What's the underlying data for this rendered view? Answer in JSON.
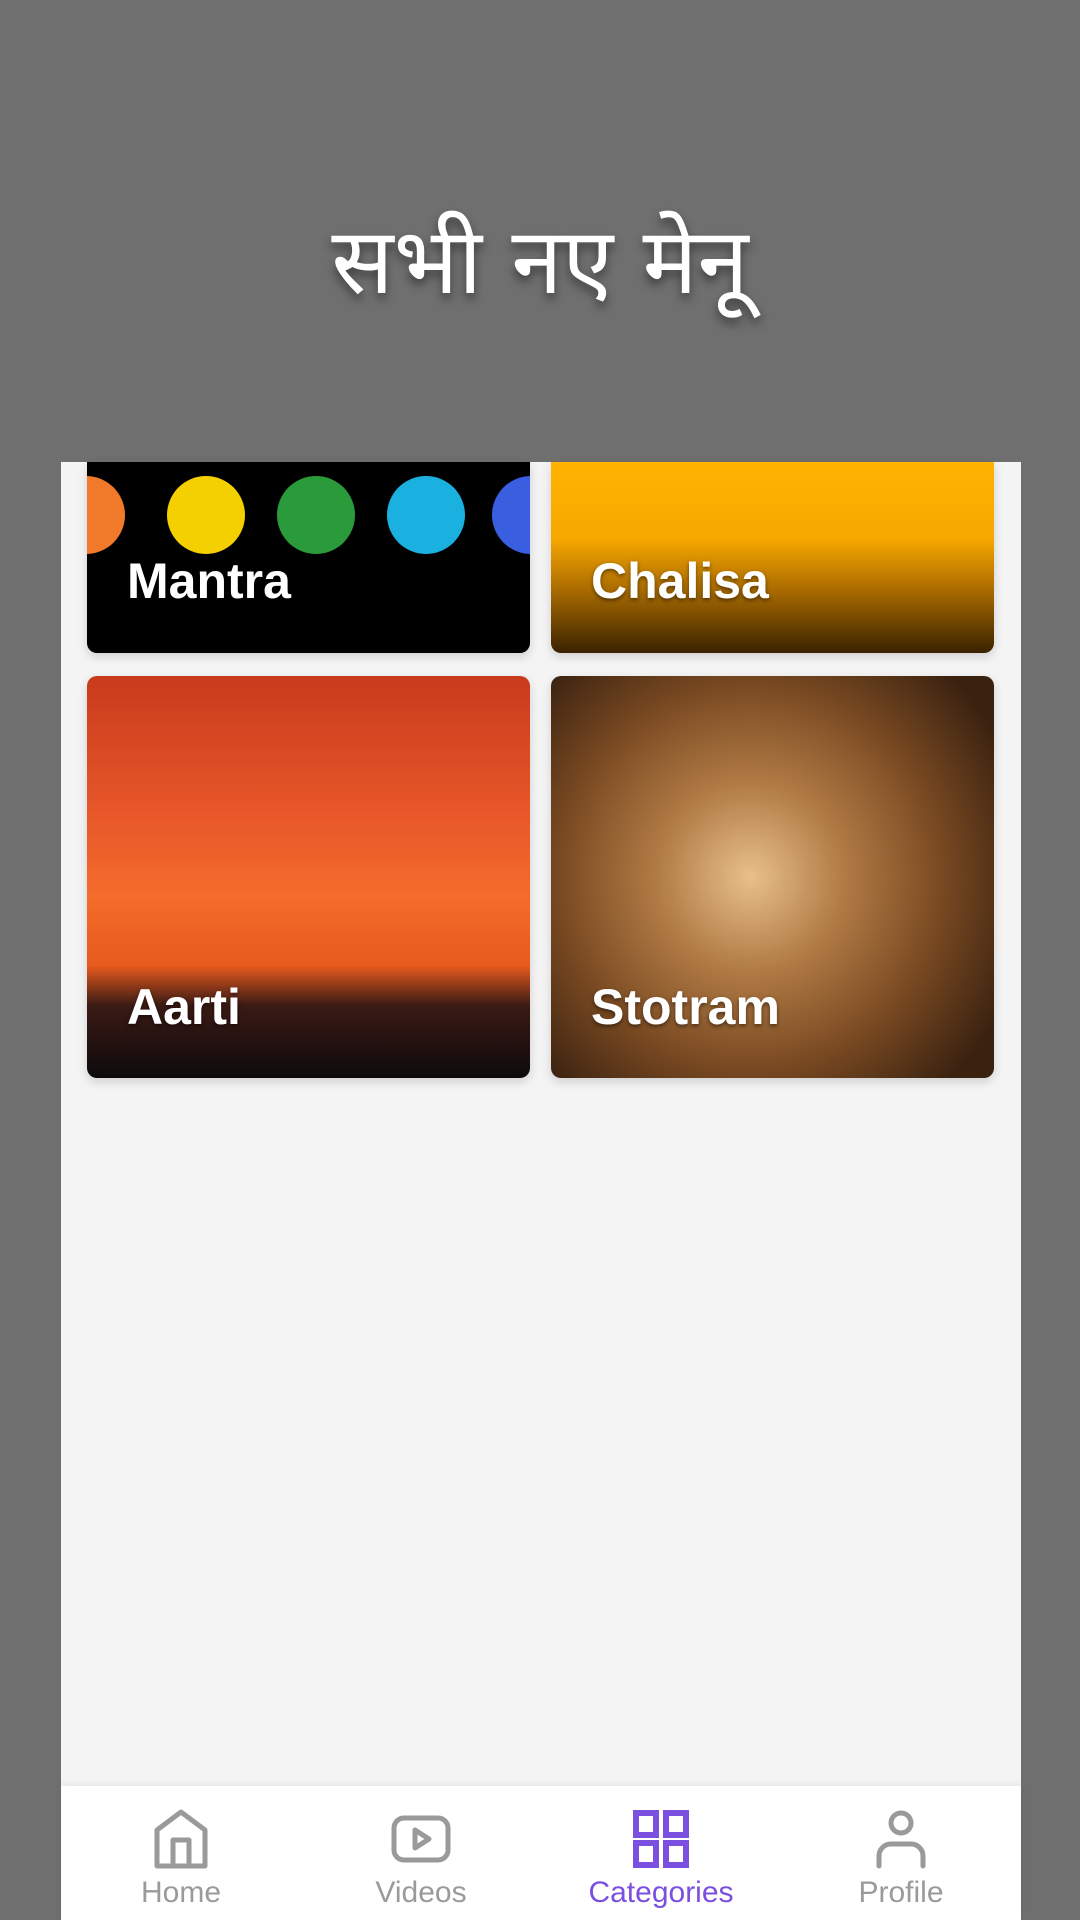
{
  "header": {
    "title": "सभी नए मेनू"
  },
  "categories": [
    {
      "label": "Mantra"
    },
    {
      "label": "Chalisa"
    },
    {
      "label": "Aarti"
    },
    {
      "label": "Stotram"
    }
  ],
  "nav": {
    "items": [
      {
        "label": "Home",
        "icon": "home-icon"
      },
      {
        "label": "Videos",
        "icon": "video-icon"
      },
      {
        "label": "Categories",
        "icon": "grid-icon",
        "active": true
      },
      {
        "label": "Profile",
        "icon": "user-icon"
      }
    ],
    "active_color": "#7b4fe0",
    "inactive_color": "#9a9a9a"
  }
}
